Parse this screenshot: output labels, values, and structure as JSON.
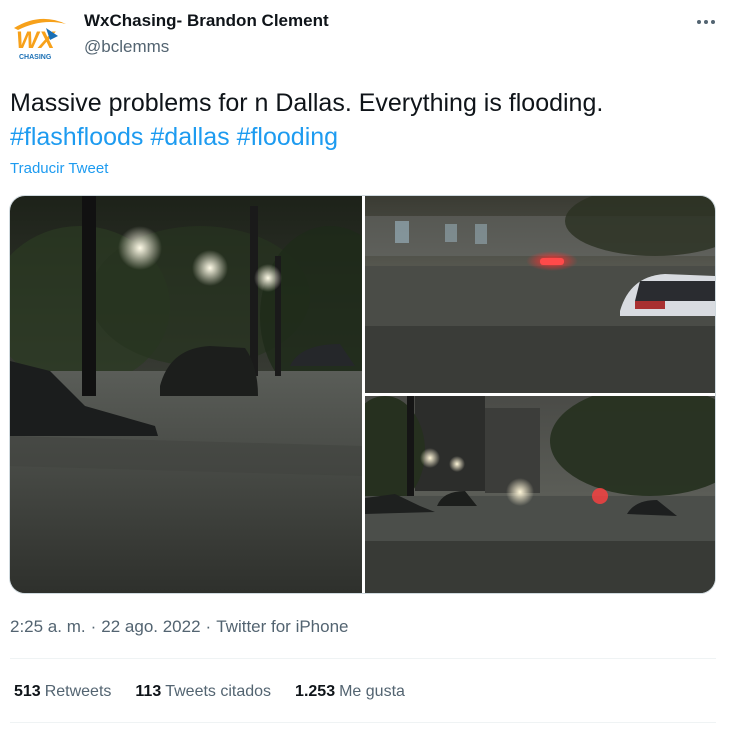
{
  "author": {
    "name": "WxChasing- Brandon Clement",
    "handle": "@bclemms",
    "avatar_text": "WX",
    "avatar_subtext": "CHASING"
  },
  "tweet": {
    "text": "Massive problems for n Dallas. Everything is flooding.",
    "hashtags": [
      "#flashfloods",
      "#dallas",
      "#flooding"
    ],
    "translate_label": "Traducir Tweet"
  },
  "media": [
    {
      "description": "flooded street at night with submerged cars and street lights"
    },
    {
      "description": "flooded parking lot with submerged car and red emergency light"
    },
    {
      "description": "flooded street with buildings and submerged cars in rain"
    }
  ],
  "meta": {
    "time": "2:25 a. m.",
    "date": "22 ago. 2022",
    "source": "Twitter for iPhone",
    "separator": "·"
  },
  "stats": {
    "retweets_count": "513",
    "retweets_label": "Retweets",
    "quotes_count": "113",
    "quotes_label": "Tweets citados",
    "likes_count": "1.253",
    "likes_label": "Me gusta"
  },
  "icons": {
    "more": "more-horizontal-icon"
  },
  "colors": {
    "link": "#1d9bf0",
    "secondary_text": "#536471",
    "primary_text": "#0f1419",
    "avatar_orange": "#f7a11a",
    "avatar_blue": "#1a6fb5"
  }
}
